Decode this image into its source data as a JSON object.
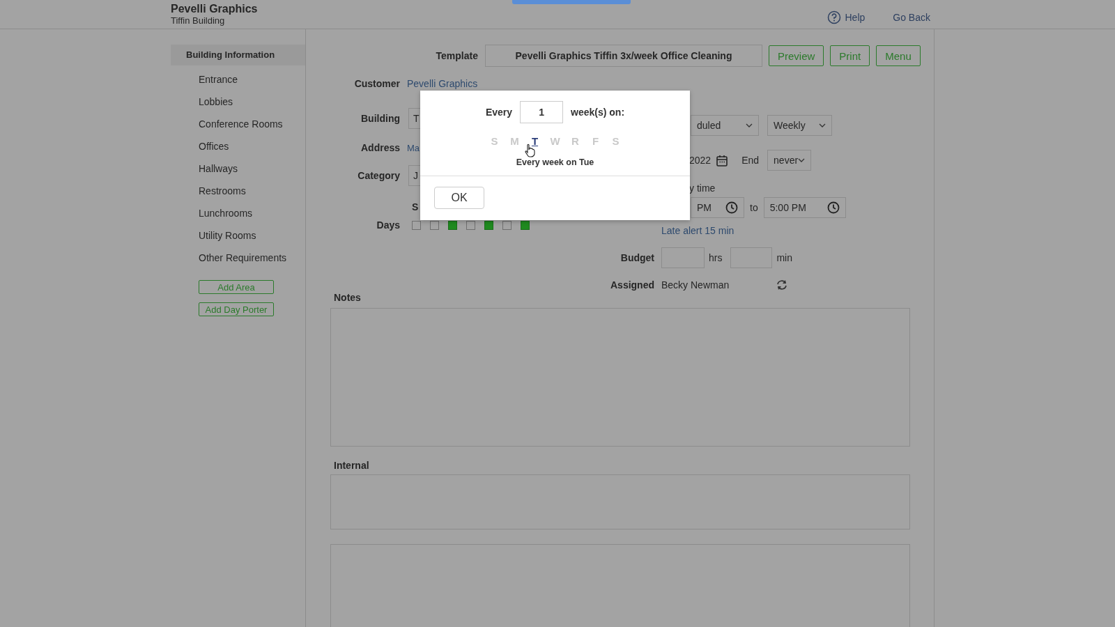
{
  "header": {
    "company": "Pevelli Graphics",
    "building": "Tiffin Building",
    "help": "Help",
    "back": "Go Back"
  },
  "sidebar": {
    "heading": "Building Information",
    "items": [
      "Entrance",
      "Lobbies",
      "Conference Rooms",
      "Offices",
      "Hallways",
      "Restrooms",
      "Lunchrooms",
      "Utility Rooms",
      "Other Requirements"
    ],
    "buttons": [
      "Add Area",
      "Add Day Porter"
    ]
  },
  "template": {
    "label": "Template",
    "value": "Pevelli Graphics Tiffin 3x/week Office Cleaning",
    "buttons": [
      "Preview",
      "Print",
      "Menu"
    ]
  },
  "form": {
    "customer": {
      "label": "Customer",
      "value": "Pevelli Graphics"
    },
    "building": {
      "label": "Building",
      "value": "T"
    },
    "address": {
      "label": "Address",
      "value": "Ma"
    },
    "category": {
      "label": "Category",
      "value": "J"
    },
    "days": {
      "label": "Days",
      "header": "S",
      "boxes": [
        {
          "checked": false
        },
        {
          "checked": false
        },
        {
          "checked": true
        },
        {
          "checked": false
        },
        {
          "checked": true
        },
        {
          "checked": false
        },
        {
          "checked": true
        }
      ]
    }
  },
  "schedule": {
    "status": "duled",
    "frequency": "Weekly",
    "start_date": "2022",
    "end_label": "End",
    "end": "never",
    "time_label": "y time",
    "from": "PM",
    "to_label": "to",
    "to": "5:00 PM",
    "late_alert": "Late alert 15 min",
    "budget": {
      "label": "Budget",
      "hours_unit": "hrs",
      "minutes_unit": "min"
    },
    "assigned": {
      "label": "Assigned",
      "value": "Becky Newman"
    }
  },
  "notes": {
    "label": "Notes"
  },
  "internal": {
    "label": "Internal"
  },
  "dialog": {
    "every_label": "Every",
    "interval": "1",
    "unit_label": "week(s) on:",
    "days": [
      {
        "label": "S",
        "selected": false
      },
      {
        "label": "M",
        "selected": false
      },
      {
        "label": "T",
        "selected": true
      },
      {
        "label": "W",
        "selected": false
      },
      {
        "label": "R",
        "selected": false
      },
      {
        "label": "F",
        "selected": false
      },
      {
        "label": "S",
        "selected": false
      }
    ],
    "summary": "Every week on Tue",
    "ok": "OK"
  }
}
